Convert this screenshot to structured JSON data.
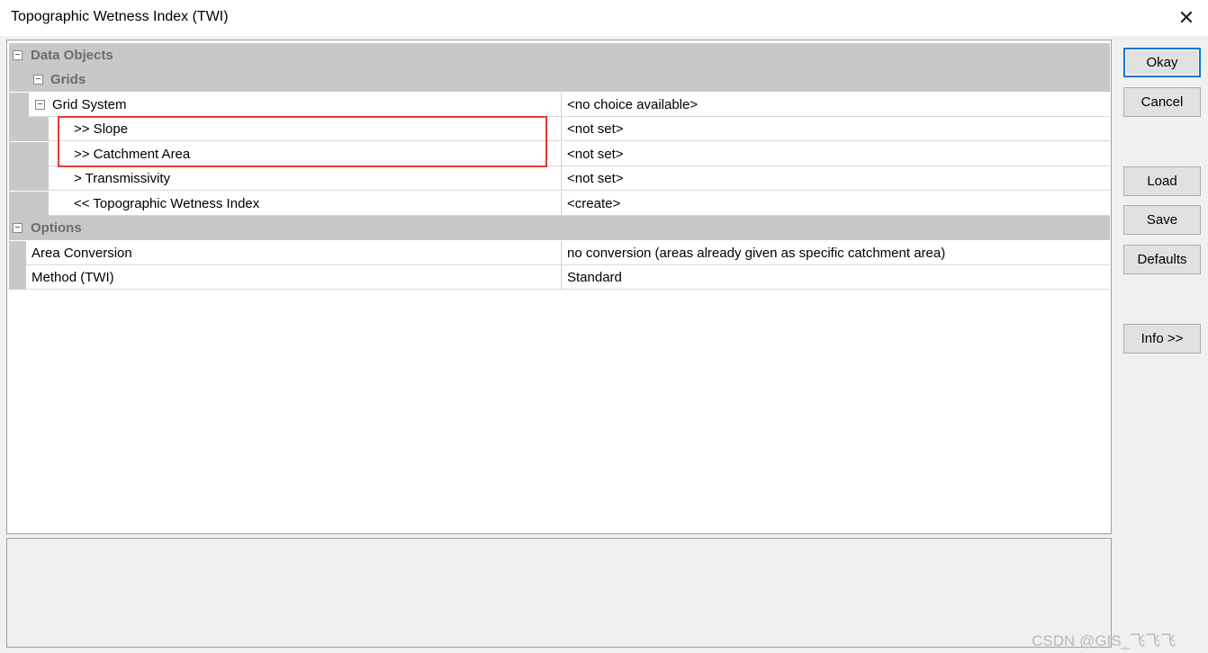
{
  "window": {
    "title": "Topographic Wetness Index (TWI)",
    "close_glyph": "✕"
  },
  "props": {
    "data_objects_label": "Data Objects",
    "grids_label": "Grids",
    "grid_system": {
      "name": "Grid System",
      "value": "<no choice available>"
    },
    "slope": {
      "name": ">> Slope",
      "value": "<not set>"
    },
    "catchment": {
      "name": ">> Catchment Area",
      "value": "<not set>"
    },
    "transmissivity": {
      "name": "> Transmissivity",
      "value": "<not set>"
    },
    "twi_output": {
      "name": "<< Topographic Wetness Index",
      "value": "<create>"
    },
    "options_label": "Options",
    "area_conversion": {
      "name": "Area Conversion",
      "value": "no conversion (areas already given as specific catchment area)"
    },
    "method": {
      "name": "Method (TWI)",
      "value": "Standard"
    }
  },
  "toggle_glyph": "−",
  "buttons": {
    "okay": "Okay",
    "cancel": "Cancel",
    "load": "Load",
    "save": "Save",
    "defaults": "Defaults",
    "info": "Info >>"
  },
  "watermark": "CSDN @GIS_飞飞飞",
  "colors": {
    "category_bg": "#c8c8c8",
    "highlight_border": "#e53935",
    "default_button_border": "#0078d7"
  }
}
